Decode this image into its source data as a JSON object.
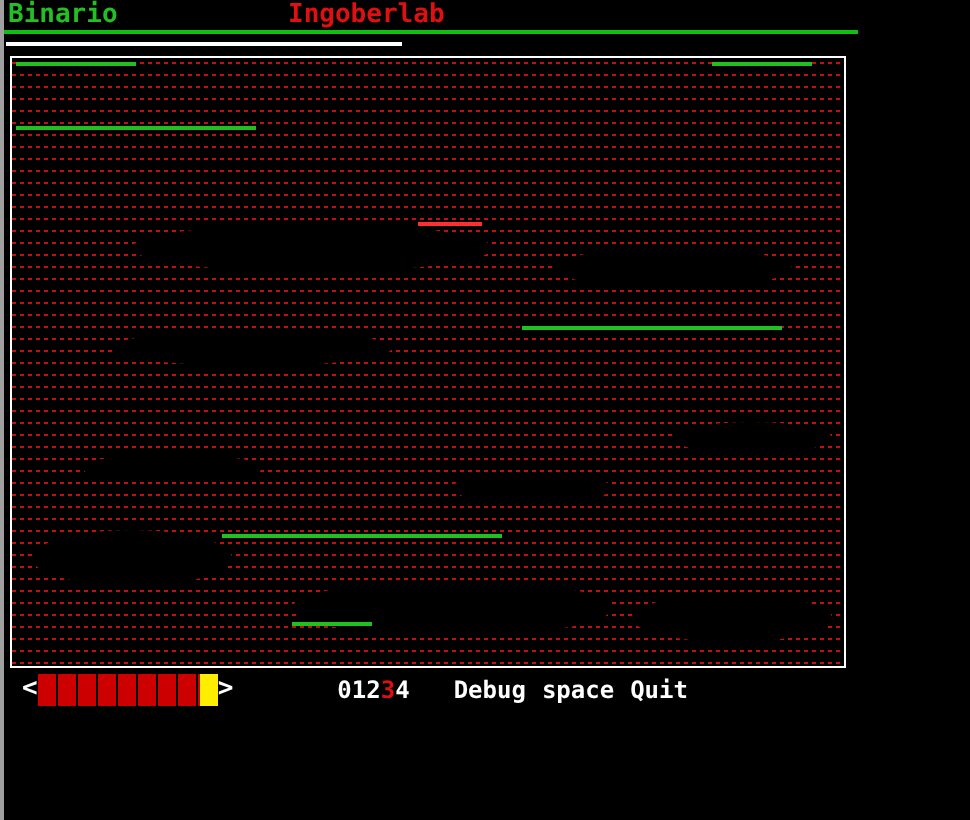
{
  "header": {
    "app_name": "Binario",
    "lab_name": "Ingoberlab"
  },
  "progress": {
    "left_arrow": "<",
    "right_arrow": ">",
    "level": 0.9
  },
  "levels": [
    {
      "label": "0",
      "selected": false
    },
    {
      "label": "1",
      "selected": false
    },
    {
      "label": "2",
      "selected": false
    },
    {
      "label": "3",
      "selected": true
    },
    {
      "label": "4",
      "selected": false
    }
  ],
  "menu": [
    "Debug",
    "space",
    "Quit"
  ]
}
